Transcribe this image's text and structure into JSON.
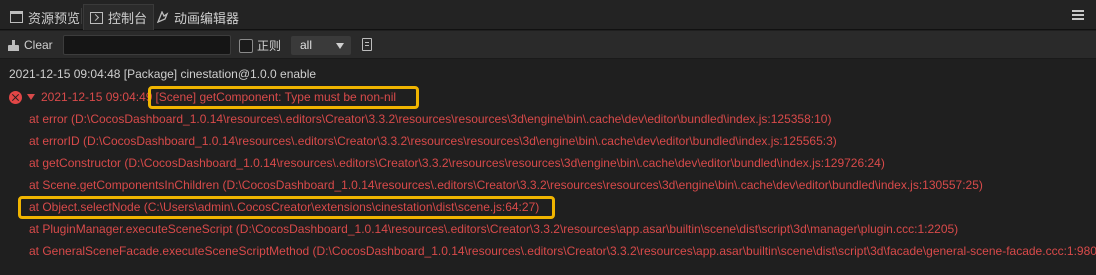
{
  "tabs": [
    {
      "label": "资源预览",
      "icon": "folder-icon"
    },
    {
      "label": "控制台",
      "icon": "console-icon"
    },
    {
      "label": "动画编辑器",
      "icon": "animation-icon"
    }
  ],
  "toolbar": {
    "clear_label": "Clear",
    "search_value": "",
    "regex_label": "正则",
    "level_selected": "all"
  },
  "log": {
    "info": "2021-12-15 09:04:48 [Package] cinestation@1.0.0 enable",
    "error_time": "2021-12-15 09:04:49",
    "error_message": "[Scene] getComponent: Type must be non-nil",
    "stack": [
      "at error (D:\\CocosDashboard_1.0.14\\resources\\.editors\\Creator\\3.3.2\\resources\\resources\\3d\\engine\\bin\\.cache\\dev\\editor\\bundled\\index.js:125358:10)",
      "at errorID (D:\\CocosDashboard_1.0.14\\resources\\.editors\\Creator\\3.3.2\\resources\\resources\\3d\\engine\\bin\\.cache\\dev\\editor\\bundled\\index.js:125565:3)",
      "at getConstructor (D:\\CocosDashboard_1.0.14\\resources\\.editors\\Creator\\3.3.2\\resources\\resources\\3d\\engine\\bin\\.cache\\dev\\editor\\bundled\\index.js:129726:24)",
      "at Scene.getComponentsInChildren (D:\\CocosDashboard_1.0.14\\resources\\.editors\\Creator\\3.3.2\\resources\\resources\\3d\\engine\\bin\\.cache\\dev\\editor\\bundled\\index.js:130557:25)",
      "at Object.selectNode (C:\\Users\\admin\\.CocosCreator\\extensions\\cinestation\\dist\\scene.js:64:27)",
      "at PluginManager.executeSceneScript (D:\\CocosDashboard_1.0.14\\resources\\.editors\\Creator\\3.3.2\\resources\\app.asar\\builtin\\scene\\dist\\script\\3d\\manager\\plugin.ccc:1:2205)",
      "at GeneralSceneFacade.executeSceneScriptMethod (D:\\CocosDashboard_1.0.14\\resources\\.editors\\Creator\\3.3.2\\resources\\app.asar\\builtin\\scene\\dist\\script\\3d\\facade\\general-scene-facade.ccc:1:980"
    ]
  },
  "colors": {
    "error": "#d84a4a",
    "highlight": "#f0b400"
  }
}
